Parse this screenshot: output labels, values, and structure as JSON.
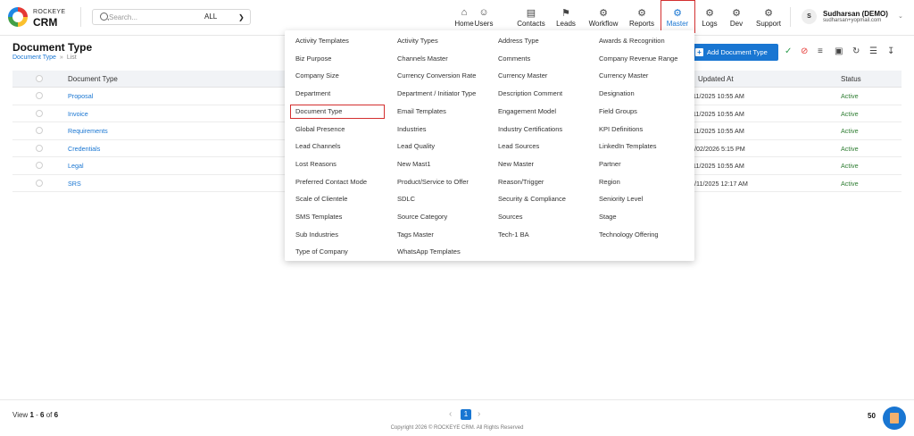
{
  "brand": {
    "line1": "ROCKEYE",
    "line2": "CRM"
  },
  "search": {
    "placeholder": "Search...",
    "scope": "ALL",
    "scope_icon": "chevron-down"
  },
  "nav": [
    {
      "label": "Home",
      "icon": "home"
    },
    {
      "label": "Users",
      "icon": "user"
    },
    {
      "label": "Contacts",
      "icon": "contacts"
    },
    {
      "label": "Leads",
      "icon": "flag"
    },
    {
      "label": "Workflow",
      "icon": "gear"
    },
    {
      "label": "Reports",
      "icon": "gear"
    },
    {
      "label": "Master",
      "icon": "gear",
      "active": true
    },
    {
      "label": "Logs",
      "icon": "gear"
    },
    {
      "label": "Dev",
      "icon": "gear"
    },
    {
      "label": "Support",
      "icon": "gear"
    }
  ],
  "user": {
    "initial": "S",
    "name": "Sudharsan (DEMO)",
    "email": "sudharsan+yopmail.com"
  },
  "page": {
    "title": "Document Type",
    "breadcrumb": {
      "link": "Document Type",
      "current": "List"
    },
    "add_button": "Add Document Type"
  },
  "table": {
    "headers": {
      "name": "Document Type",
      "updated": "Updated At",
      "status": "Status"
    },
    "rows": [
      {
        "name": "Proposal",
        "updated": "/11/2025 10:55 AM",
        "status": "Active"
      },
      {
        "name": "Invoice",
        "updated": "/11/2025 10:55 AM",
        "status": "Active"
      },
      {
        "name": "Requirements",
        "updated": "/11/2025 10:55 AM",
        "status": "Active"
      },
      {
        "name": "Credentials",
        "updated": "5/02/2026 5:15 PM",
        "status": "Active"
      },
      {
        "name": "Legal",
        "updated": "/11/2025 10:55 AM",
        "status": "Active"
      },
      {
        "name": "SRS",
        "updated": "3/11/2025 12:17 AM",
        "status": "Active"
      }
    ]
  },
  "menu": {
    "columns": [
      [
        "Activity Templates",
        "Biz Purpose",
        "Company Size",
        "Department",
        "Document Type",
        "Global Presence",
        "Lead Channels",
        "Lost Reasons",
        "Preferred Contact Mode",
        "Scale of Clientele",
        "SMS Templates",
        "Sub Industries",
        "Type of Company"
      ],
      [
        "Activity Types",
        "Channels Master",
        "Currency Conversion Rate",
        "Department / Initiator Type",
        "Email Templates",
        "Industries",
        "Lead Quality",
        "New Mast1",
        "Product/Service to Offer",
        "SDLC",
        "Source Category",
        "Tags Master",
        "WhatsApp Templates"
      ],
      [
        "Address Type",
        "Comments",
        "Currency Master",
        "Description Comment",
        "Engagement Model",
        "Industry Certifications",
        "Lead Sources",
        "New Master",
        "Reason/Trigger",
        "Security & Compliance",
        "Sources",
        "Tech-1 BA"
      ],
      [
        "Awards & Recognition",
        "Company Revenue Range",
        "Currency Master",
        "Designation",
        "Field Groups",
        "KPI Definitions",
        "LinkedIn Templates",
        "Partner",
        "Region",
        "Seniority Level",
        "Stage",
        "Technology Offering"
      ]
    ],
    "highlighted": "Document Type"
  },
  "footer": {
    "view_prefix": "View",
    "view_from": "1",
    "view_to": "6",
    "view_of": "of",
    "view_total": "6",
    "current_page": "1",
    "copyright": "Copyright 2026 © ROCKEYE CRM. All Rights Reserved",
    "page_size": "50"
  },
  "colors": {
    "accent": "#1976d2",
    "highlight": "#d32f2f",
    "status_active": "#2e7d32"
  }
}
